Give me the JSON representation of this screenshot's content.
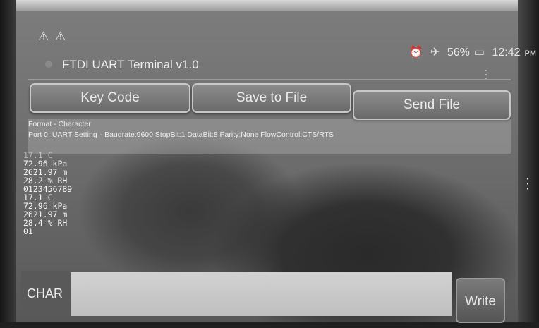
{
  "status_bar": {
    "warning_icons": "⚠ ⚠",
    "alarm_icon": "⏰",
    "airplane_icon": "✈",
    "battery_percent": "56%",
    "battery_icon": "▭",
    "time": "12:42",
    "ampm": "PM"
  },
  "app": {
    "title": "FTDI UART Terminal v1.0"
  },
  "buttons": {
    "key_code": "Key Code",
    "save_to_file": "Save to File",
    "send_file": "Send File"
  },
  "format": {
    "format_text": "Format - Character",
    "port_text": "Port 0; UART Setting",
    "setting_text": "-  Baudrate:9600  StopBit:1  DataBit:8  Parity:None  FlowControl:CTS/RTS"
  },
  "terminal": {
    "lines": [
      "17.1 C",
      "72.96 kPa",
      "2621.97 m",
      "28.2 % RH",
      "0123456789",
      "17.1 C",
      "72.96 kPa",
      "2621.97 m",
      "28.4 % RH",
      "01"
    ]
  },
  "input_row": {
    "char_label": "CHAR",
    "write_value": "",
    "write_button": "Write"
  },
  "colors": {
    "button_fill": "#7a7a7a",
    "button_border": "#c8c8c8",
    "input_fill": "#c8c8c8"
  }
}
